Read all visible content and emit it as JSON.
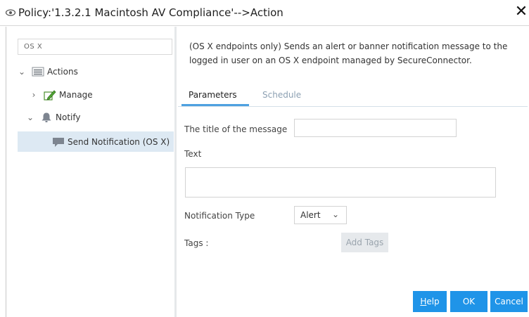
{
  "window": {
    "title": "Policy:'1.3.2.1 Macintosh AV Compliance'-->Action",
    "close_glyph": "✕",
    "icon": "eye-icon"
  },
  "sidebar": {
    "search_value": "OS X",
    "tree": [
      {
        "label": "Actions",
        "icon": "list-icon",
        "expanded": true
      },
      {
        "label": "Manage",
        "icon": "manage-pencil-icon",
        "expanded": false
      },
      {
        "label": "Notify",
        "icon": "bell-icon",
        "expanded": true
      },
      {
        "label": "Send Notification (OS X)",
        "icon": "message-icon",
        "selected": true
      }
    ]
  },
  "main": {
    "description": "(OS X endpoints only) Sends an alert or banner notification message to the logged in user on an OS X endpoint managed by SecureConnector.",
    "tabs": [
      {
        "label": "Parameters",
        "active": true
      },
      {
        "label": "Schedule",
        "active": false
      }
    ],
    "form": {
      "title_label": "The title of the message",
      "title_value": "",
      "text_label": "Text",
      "text_value": "",
      "notification_type_label": "Notification Type",
      "notification_type_value": "Alert",
      "tags_label": "Tags :",
      "add_tags_label": "Add Tags"
    }
  },
  "footer": {
    "help_label": "Help",
    "ok_label": "OK",
    "cancel_label": "Cancel"
  },
  "colors": {
    "accent": "#1f94e8",
    "selection": "#dde9f3",
    "tab_underline": "#4ea1e0"
  }
}
